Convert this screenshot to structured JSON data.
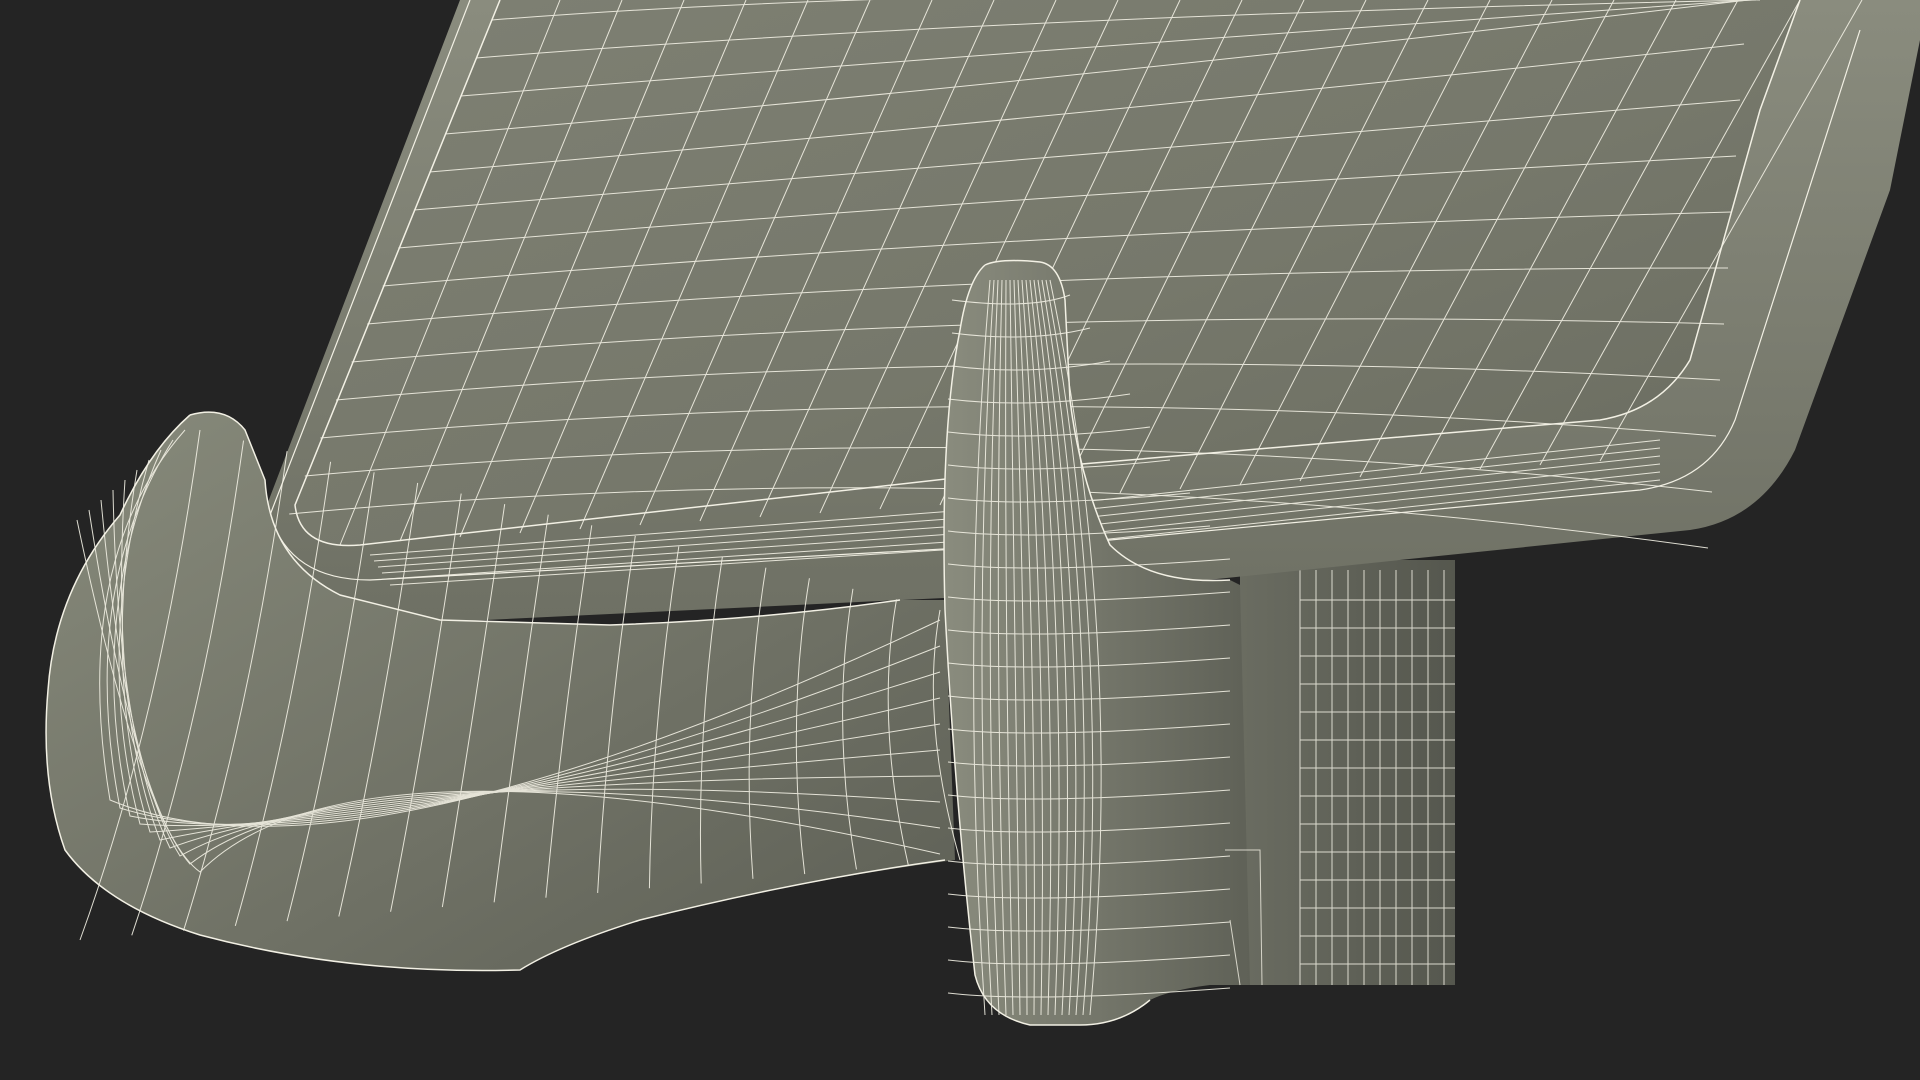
{
  "scene": {
    "subject": "tablet-stand-wireframe",
    "parts": [
      "tablet-body",
      "stand-hook",
      "stand-base",
      "center-support",
      "rear-leg"
    ]
  },
  "colors": {
    "background": "#242424",
    "surface_light": "#828475",
    "surface_mid": "#6c6e62",
    "surface_dark": "#4f5148",
    "wire": "#f2f0e4"
  }
}
